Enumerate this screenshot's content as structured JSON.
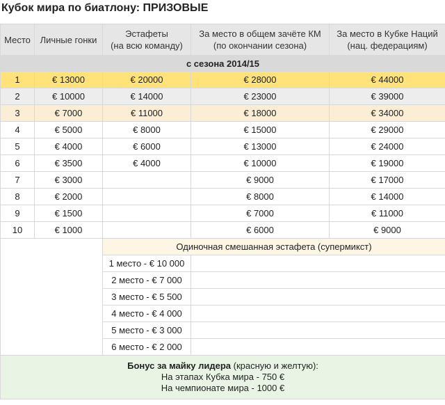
{
  "title": "Кубок мира по биатлону: ПРИЗОВЫЕ",
  "headers": {
    "place": "Место",
    "individual": "Личные гонки",
    "relay_line1": "Эстафеты",
    "relay_line2": "(на всю команду)",
    "overall_line1": "За место в общем зачёте КМ",
    "overall_line2": "(по окончании сезона)",
    "nations_line1": "За место в Кубке Наций",
    "nations_line2": "(нац. федерациям)"
  },
  "season_label": "с сезона 2014/15",
  "rows": [
    {
      "place": "1",
      "individual": "€ 13000",
      "relay": "€ 20000",
      "overall": "€ 28000",
      "nations": "€ 44000"
    },
    {
      "place": "2",
      "individual": "€ 10000",
      "relay": "€ 14000",
      "overall": "€ 23000",
      "nations": "€ 39000"
    },
    {
      "place": "3",
      "individual": "€ 7000",
      "relay": "€ 11000",
      "overall": "€ 18000",
      "nations": "€ 34000"
    },
    {
      "place": "4",
      "individual": "€ 5000",
      "relay": "€ 8000",
      "overall": "€ 15000",
      "nations": "€ 29000"
    },
    {
      "place": "5",
      "individual": "€ 4000",
      "relay": "€ 6000",
      "overall": "€ 13000",
      "nations": "€ 24000"
    },
    {
      "place": "6",
      "individual": "€ 3500",
      "relay": "€ 4000",
      "overall": "€ 10000",
      "nations": "€ 19000"
    },
    {
      "place": "7",
      "individual": "€ 3000",
      "relay": "",
      "overall": "€ 9000",
      "nations": "€ 17000"
    },
    {
      "place": "8",
      "individual": "€ 2000",
      "relay": "",
      "overall": "€ 8000",
      "nations": "€ 14000"
    },
    {
      "place": "9",
      "individual": "€ 1500",
      "relay": "",
      "overall": "€ 7000",
      "nations": "€ 11000"
    },
    {
      "place": "10",
      "individual": "€ 1000",
      "relay": "",
      "overall": "€ 6000",
      "nations": "€ 9000"
    }
  ],
  "mixed_relay": {
    "title": "Одиночная смешанная эстафета (супермикст)",
    "items": [
      "1 место - € 10 000",
      "2 место - € 7 000",
      "3 место - € 5 500",
      "4 место - € 4 000",
      "5 место - € 3 000",
      "6 место - € 2 000"
    ]
  },
  "bonus": {
    "bold": "Бонус за майку лидера",
    "rest": " (красную и желтую):",
    "line2": "На этапах Кубка мира - 750 €",
    "line3": "На чемпионате мира - 1000 €"
  },
  "colors": {
    "gold_row": "#ffe27a",
    "silver_row": "#ededed",
    "bronze_row": "#fbeed5",
    "header_bg": "#e6e6e6",
    "bonus_bg": "#e8f5e4"
  }
}
